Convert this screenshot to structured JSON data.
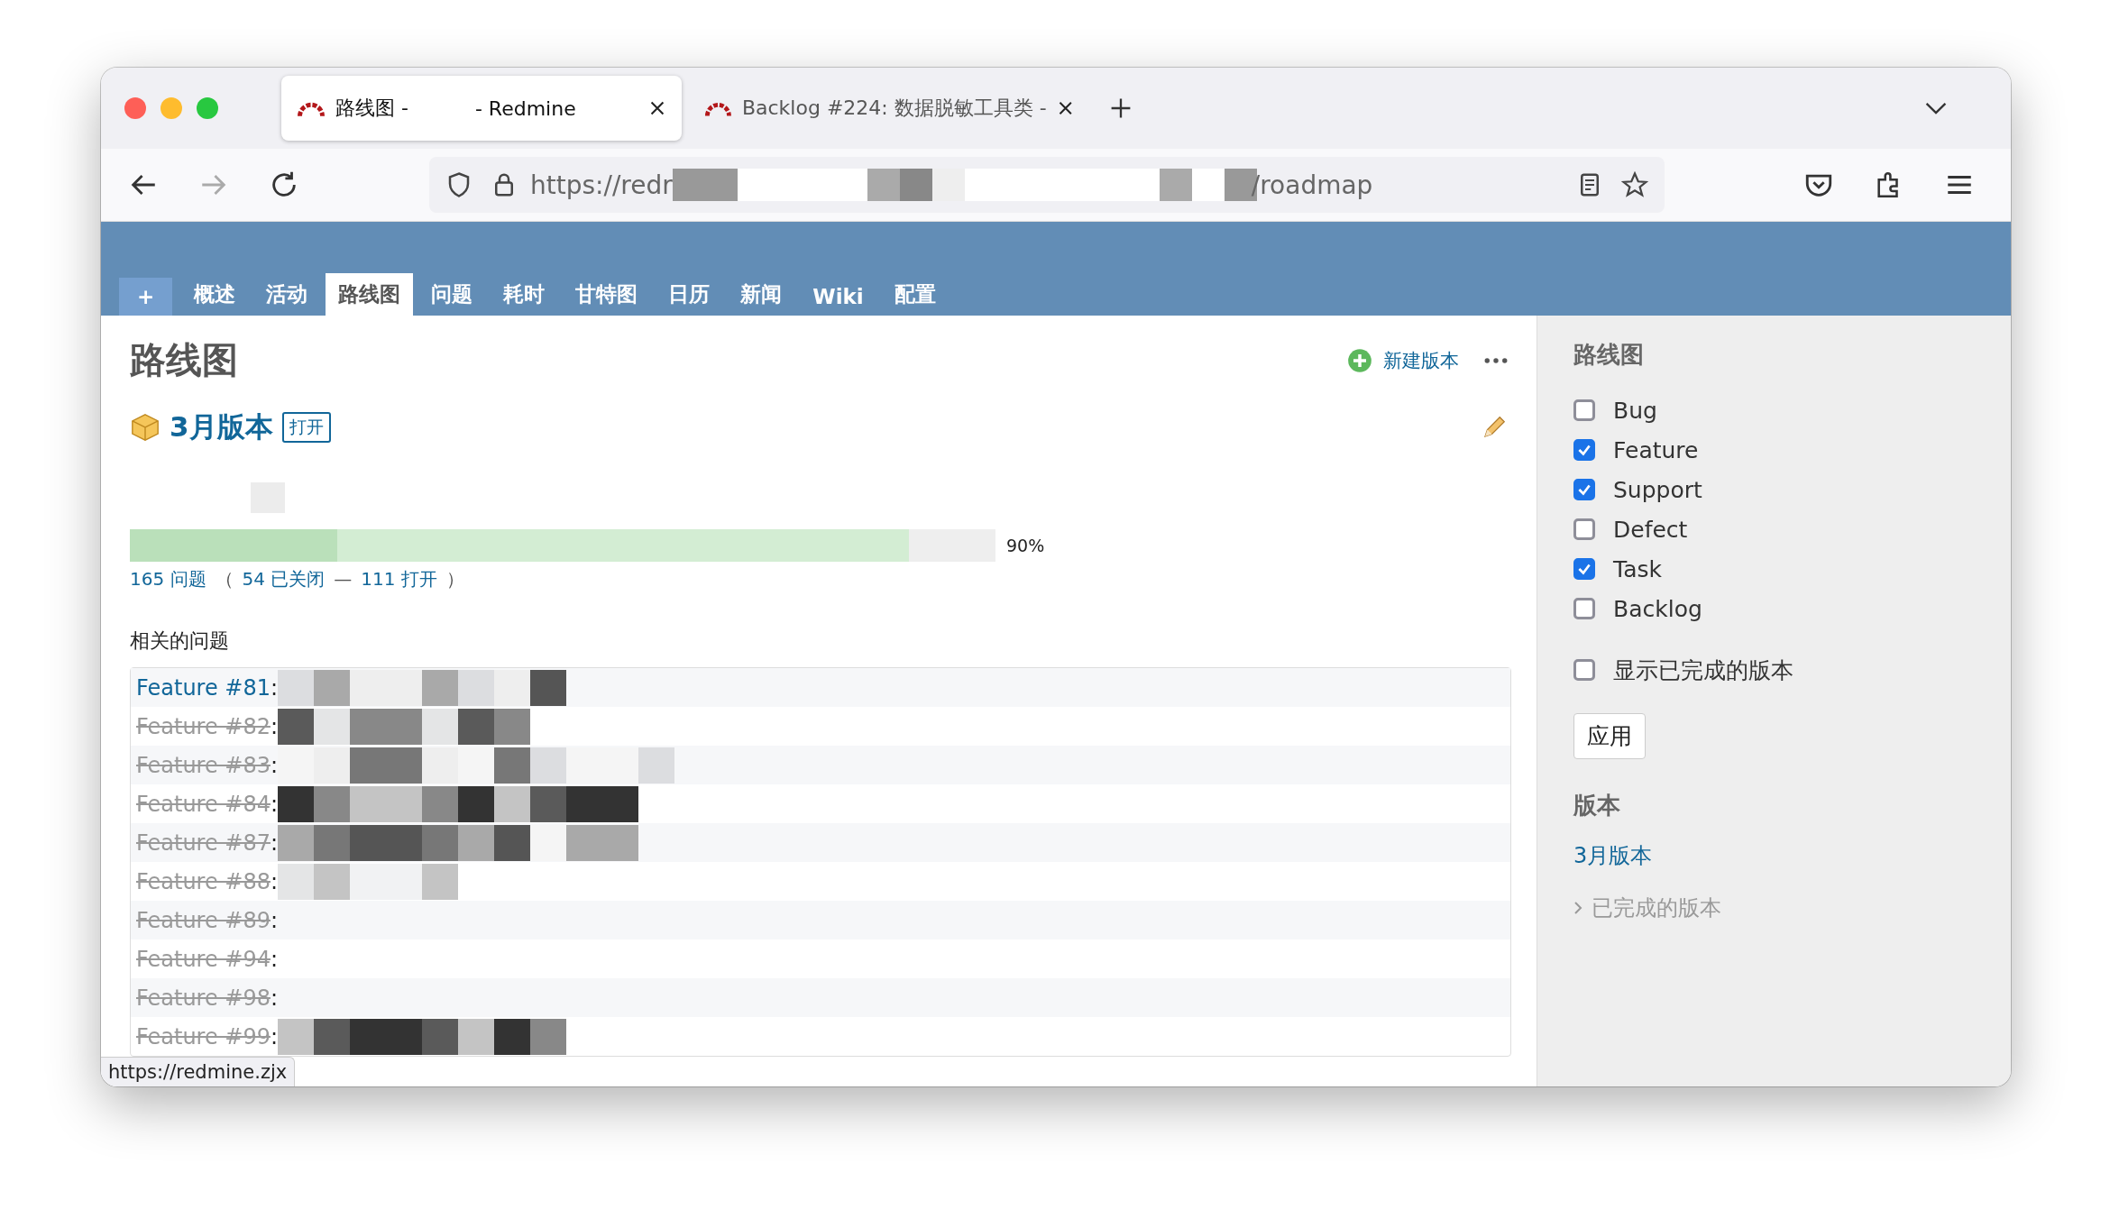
{
  "browser": {
    "tabs": [
      {
        "title": "路线图 -",
        "title_end": "- Redmine",
        "selected": true
      },
      {
        "title": "Backlog #224: 数据脱敏工具类 -",
        "selected": false
      }
    ],
    "url": {
      "start": "https://redr",
      "end": "/roadmap"
    },
    "status_url": "https://redmine.zjx"
  },
  "project_menu": {
    "new_label": "+",
    "tabs": [
      {
        "label": "概述",
        "selected": false
      },
      {
        "label": "活动",
        "selected": false
      },
      {
        "label": "路线图",
        "selected": true
      },
      {
        "label": "问题",
        "selected": false
      },
      {
        "label": "耗时",
        "selected": false
      },
      {
        "label": "甘特图",
        "selected": false
      },
      {
        "label": "日历",
        "selected": false
      },
      {
        "label": "新闻",
        "selected": false
      },
      {
        "label": "Wiki",
        "selected": false
      },
      {
        "label": "配置",
        "selected": false
      }
    ]
  },
  "main": {
    "title": "路线图",
    "new_version": "新建版本",
    "version": {
      "name": "3月版本",
      "status": "打开",
      "progress": {
        "closed": {
          "level": 0.24
        },
        "done": {
          "level": 0.9
        },
        "percent": "90%"
      },
      "issues_count": "165 问题",
      "open_paren": "（",
      "closed_count": "54 已关闭",
      "dash": "—",
      "open_count": "111 打开",
      "close_paren": "）"
    },
    "related_title": "相关的问题",
    "issues": [
      {
        "label": "Feature #81",
        "separator": ":",
        "closed": false
      },
      {
        "label": "Feature #82",
        "separator": ":",
        "closed": true
      },
      {
        "label": "Feature #83",
        "separator": ":",
        "closed": true
      },
      {
        "label": "Feature #84",
        "separator": ":",
        "closed": true
      },
      {
        "label": "Feature #87",
        "separator": ":",
        "closed": true
      },
      {
        "label": "Feature #88",
        "separator": ":",
        "closed": true
      },
      {
        "label": "Feature #89",
        "separator": ":",
        "closed": true
      },
      {
        "label": "Feature #94",
        "separator": ":",
        "closed": true
      },
      {
        "label": "Feature #98",
        "separator": ":",
        "closed": true
      },
      {
        "label": "Feature #99",
        "separator": ":",
        "closed": true
      }
    ]
  },
  "sidebar": {
    "title": "路线图",
    "trackers": [
      {
        "label": "Bug",
        "checked": false
      },
      {
        "label": "Feature",
        "checked": true
      },
      {
        "label": "Support",
        "checked": true
      },
      {
        "label": "Defect",
        "checked": false
      },
      {
        "label": "Task",
        "checked": true
      },
      {
        "label": "Backlog",
        "checked": false
      }
    ],
    "show_completed": {
      "label": "显示已完成的版本",
      "checked": false
    },
    "apply": "应用",
    "versions_title": "版本",
    "versions": [
      "3月版本"
    ],
    "completed_versions": "已完成的版本"
  }
}
